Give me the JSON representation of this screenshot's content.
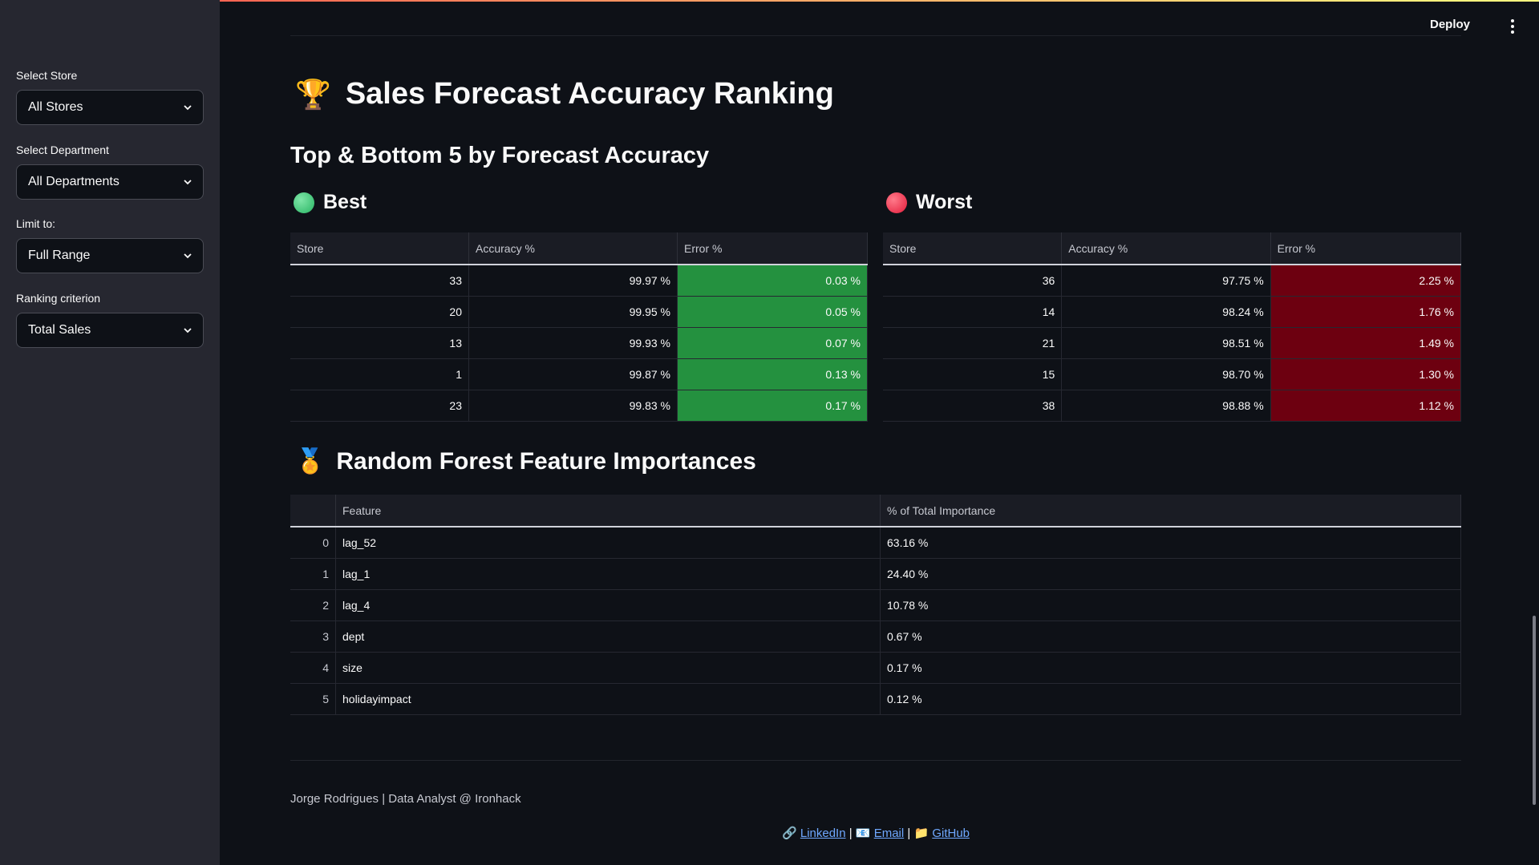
{
  "sidebar": {
    "filters": [
      {
        "label": "Select Store",
        "value": "All Stores"
      },
      {
        "label": "Select Department",
        "value": "All Departments"
      },
      {
        "label": "Limit to:",
        "value": "Full Range"
      },
      {
        "label": "Ranking criterion",
        "value": "Total Sales"
      }
    ]
  },
  "header": {
    "deploy_label": "Deploy",
    "menu_icon": "kebab-icon"
  },
  "main": {
    "title_icon": "🏆",
    "title": "Sales Forecast Accuracy Ranking",
    "subtitle": "Top & Bottom 5 by Forecast Accuracy",
    "best": {
      "heading": "Best",
      "columns": [
        "Store",
        "Accuracy %",
        "Error %"
      ],
      "rows": [
        [
          "33",
          "99.97 %",
          "0.03 %"
        ],
        [
          "20",
          "99.95 %",
          "0.05 %"
        ],
        [
          "13",
          "99.93 %",
          "0.07 %"
        ],
        [
          "1",
          "99.87 %",
          "0.13 %"
        ],
        [
          "23",
          "99.83 %",
          "0.17 %"
        ]
      ]
    },
    "worst": {
      "heading": "Worst",
      "columns": [
        "Store",
        "Accuracy %",
        "Error %"
      ],
      "rows": [
        [
          "36",
          "97.75 %",
          "2.25 %"
        ],
        [
          "14",
          "98.24 %",
          "1.76 %"
        ],
        [
          "21",
          "98.51 %",
          "1.49 %"
        ],
        [
          "15",
          "98.70 %",
          "1.30 %"
        ],
        [
          "38",
          "98.88 %",
          "1.12 %"
        ]
      ]
    },
    "features": {
      "icon": "🏅",
      "heading": "Random Forest Feature Importances",
      "columns": [
        "",
        "Feature",
        "% of Total Importance"
      ],
      "rows": [
        [
          "0",
          "lag_52",
          "63.16 %"
        ],
        [
          "1",
          "lag_1",
          "24.40 %"
        ],
        [
          "2",
          "lag_4",
          "10.78 %"
        ],
        [
          "3",
          "dept",
          "0.67 %"
        ],
        [
          "4",
          "size",
          "0.17 %"
        ],
        [
          "5",
          "holidayimpact",
          "0.12 %"
        ]
      ]
    }
  },
  "footer": {
    "credit": "Jorge Rodrigues | Data Analyst @ Ironhack",
    "link_icon": "🔗",
    "linkedin": "LinkedIn",
    "sep1": "|",
    "email_icon": "📧",
    "email": "Email",
    "sep2": "|",
    "github_icon": "📁",
    "github": "GitHub"
  },
  "colors": {
    "good": "#24913f",
    "bad": "#6d0010",
    "link": "#6fa8ff"
  }
}
